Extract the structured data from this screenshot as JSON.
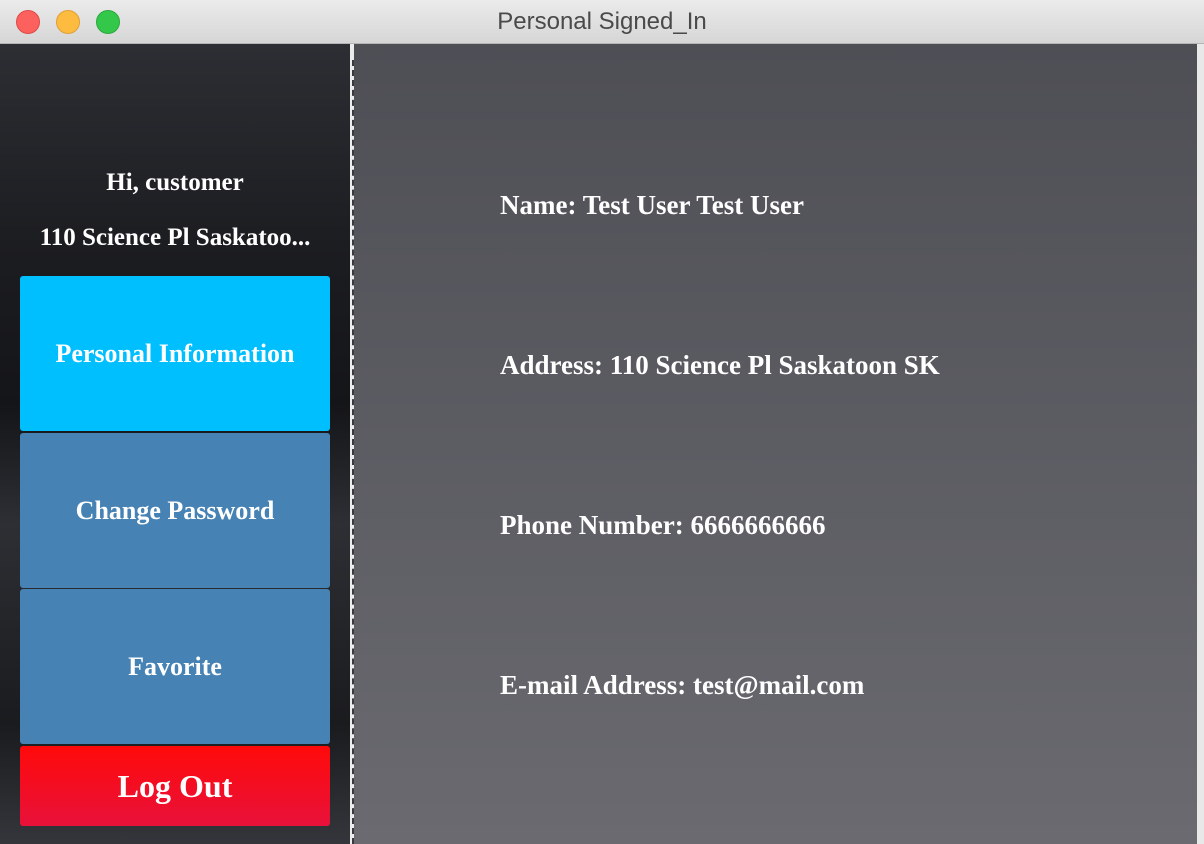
{
  "window": {
    "title": "Personal Signed_In"
  },
  "sidebar": {
    "greeting": "Hi, customer",
    "address_short": "110 Science Pl Saskatoo...",
    "nav": {
      "personal_info": "Personal Information",
      "change_password": "Change Password",
      "favorite": "Favorite",
      "logout": "Log Out"
    }
  },
  "profile": {
    "name": "Name: Test User Test User",
    "address": "Address: 110 Science Pl Saskatoon SK",
    "phone": "Phone Number: 6666666666",
    "email": "E-mail Address: test@mail.com"
  },
  "colors": {
    "active_nav": "#00bfff",
    "nav": "#4682b4",
    "logout": "#ff0a0a"
  }
}
